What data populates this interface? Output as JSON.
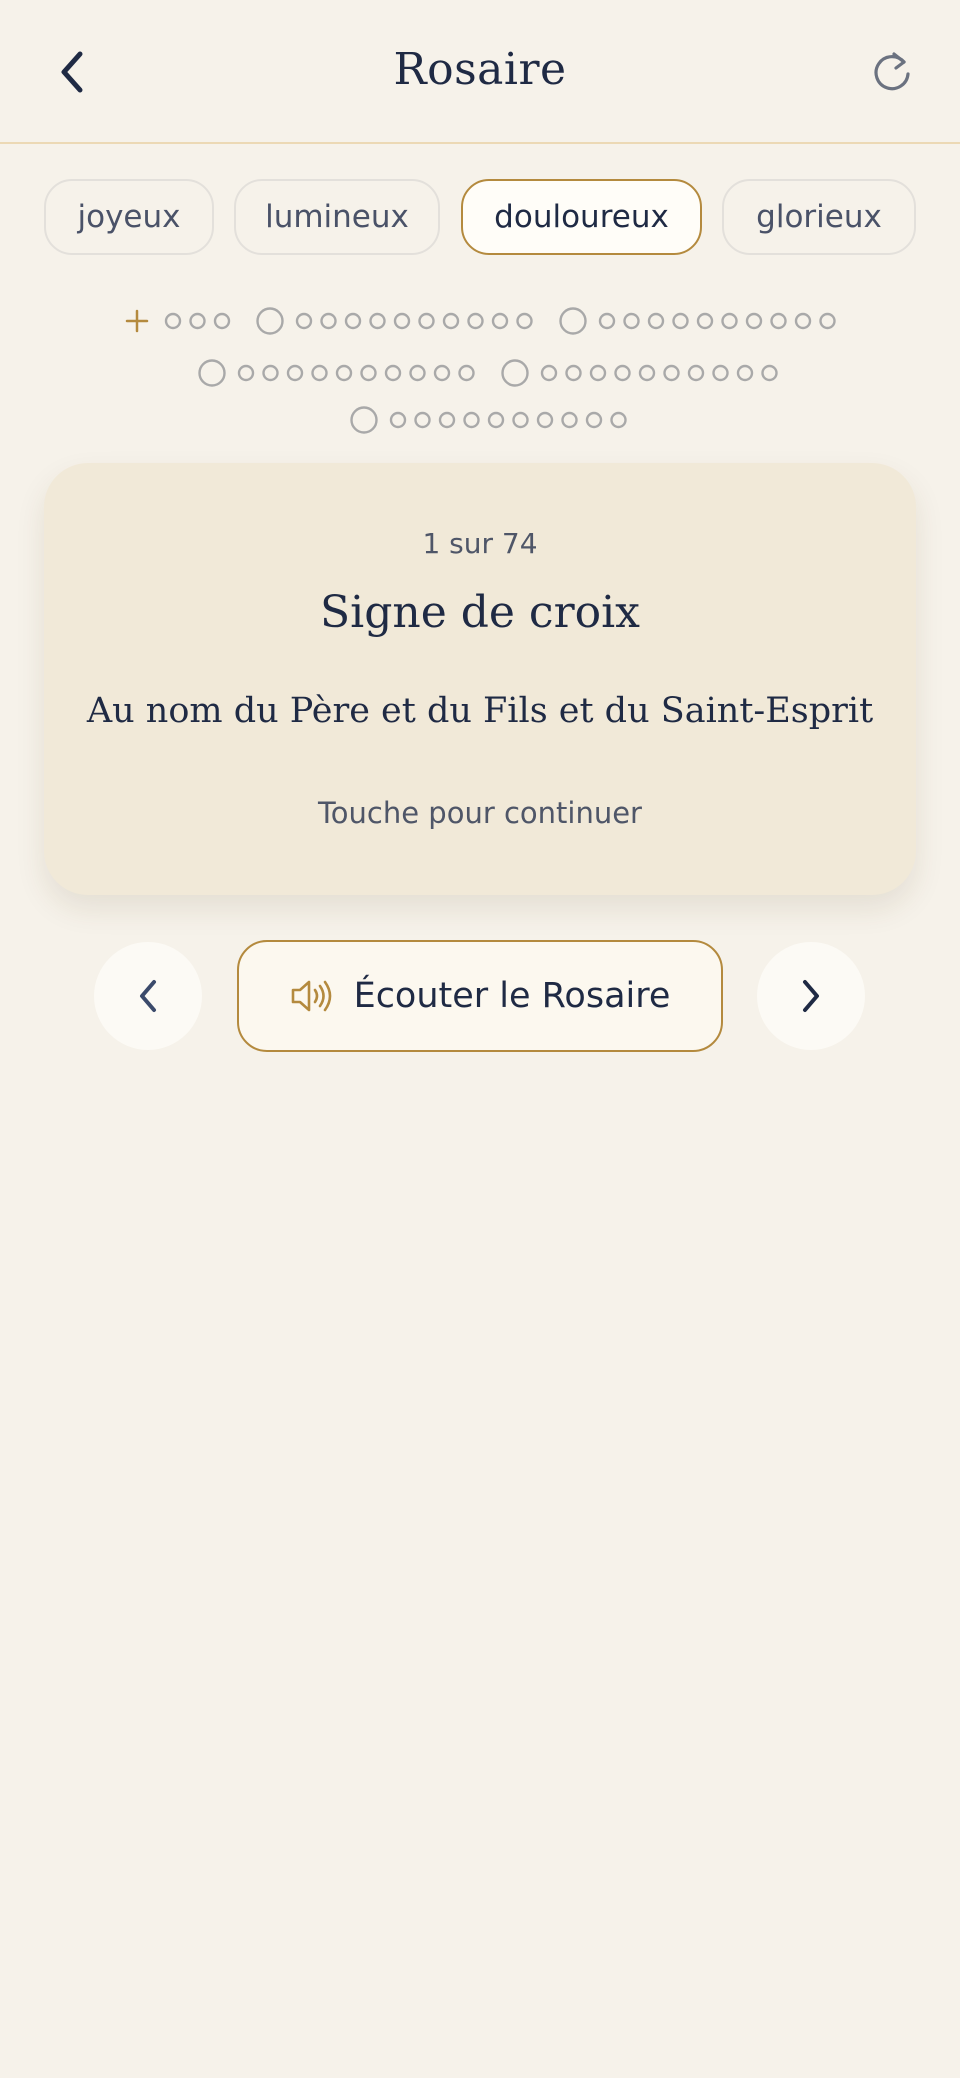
{
  "header": {
    "title": "Rosaire",
    "back_icon": "chevron-left-icon",
    "reset_icon": "refresh-icon"
  },
  "mysteries": [
    {
      "label": "joyeux",
      "active": false
    },
    {
      "label": "lumineux",
      "active": false
    },
    {
      "label": "douloureux",
      "active": true
    },
    {
      "label": "glorieux",
      "active": false
    }
  ],
  "progress": {
    "current_step": 1,
    "total_steps": 74,
    "decades": 5,
    "beads_per_decade": 10,
    "intro_small_beads": 3
  },
  "card": {
    "counter": "1 sur 74",
    "title": "Signe de croix",
    "text": "Au nom du Père et du Fils et du Saint-Esprit",
    "hint": "Touche pour continuer"
  },
  "controls": {
    "listen_label": "Écouter le Rosaire",
    "listen_icon": "speaker-icon",
    "prev_icon": "chevron-left-icon",
    "next_icon": "chevron-right-icon"
  },
  "colors": {
    "background": "#f6f2ea",
    "accent_gold": "#b48a3e",
    "navy": "#1f2a44",
    "card": "#f1e9d8",
    "bead_gray": "#a9a9a9"
  }
}
